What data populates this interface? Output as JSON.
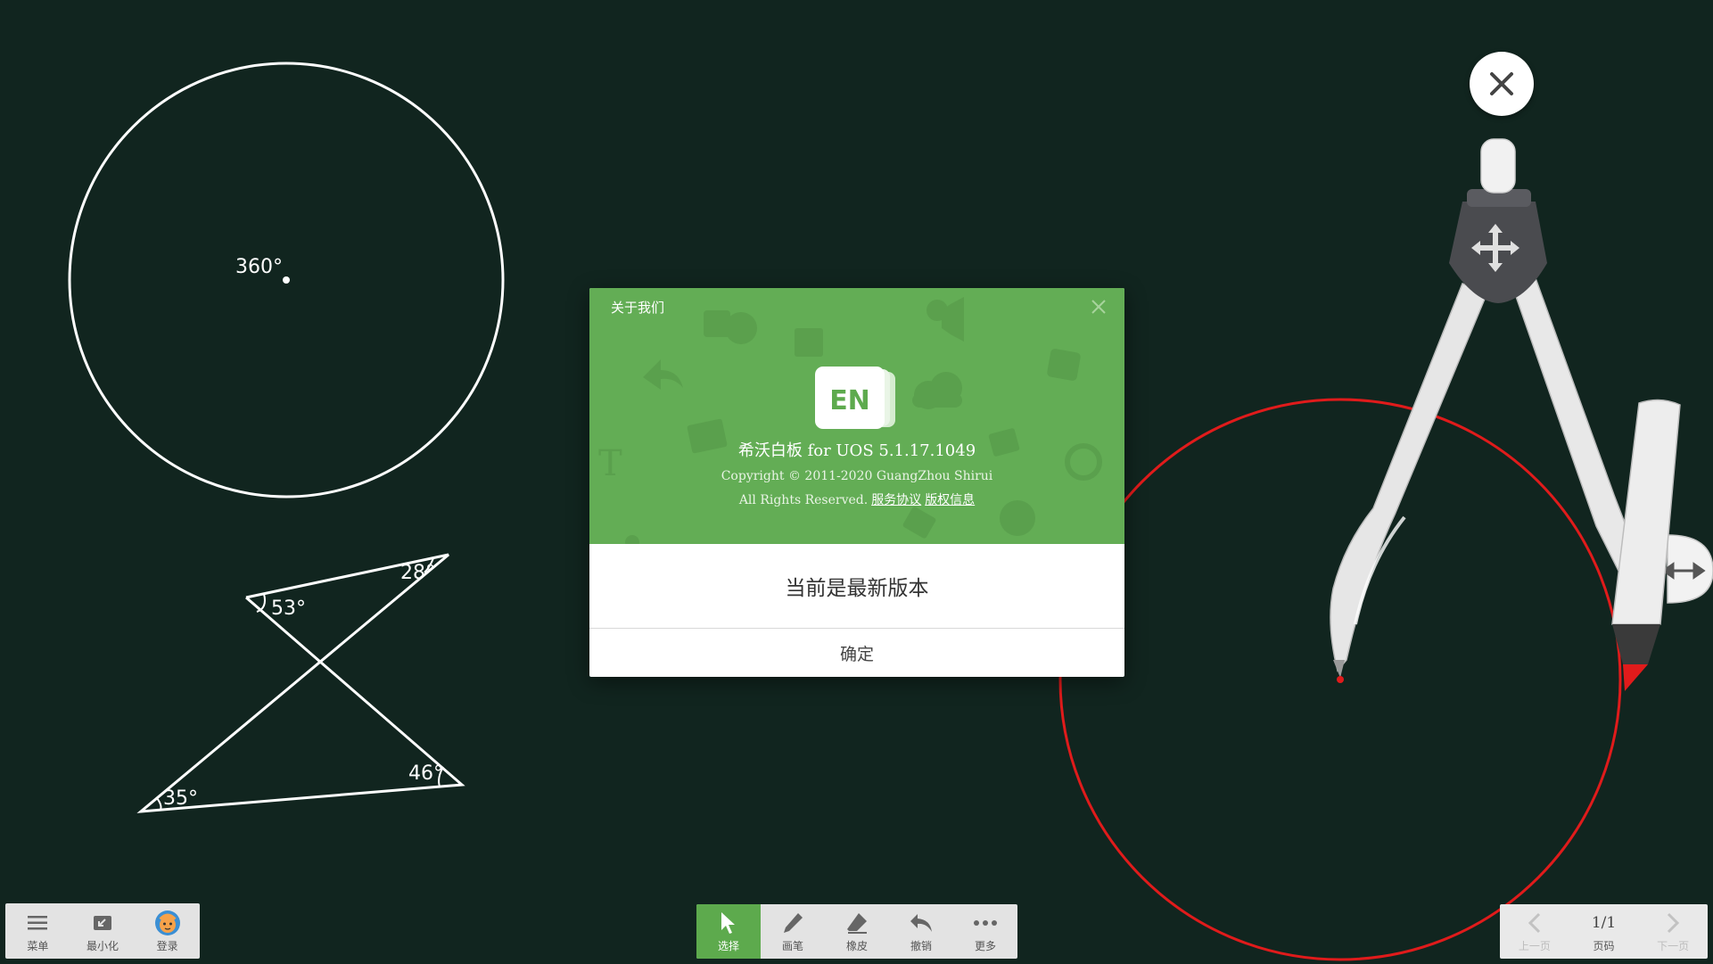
{
  "board": {
    "circle_label": "360°",
    "angles": [
      "28°",
      "53°",
      "46°",
      "35°"
    ]
  },
  "dialog": {
    "title": "关于我们",
    "app_name": "希沃白板 for UOS 5.1.17.1049",
    "copyright": "Copyright © 2011-2020 GuangZhou Shirui",
    "rights": "All Rights Reserved.",
    "link_service": "服务协议",
    "link_copyright": "版权信息",
    "logo_text": "EN",
    "status": "当前是最新版本",
    "ok_label": "确定"
  },
  "left_bar": {
    "menu_label": "菜单",
    "minimize_label": "最小化",
    "login_label": "登录"
  },
  "toolbar": {
    "select_label": "选择",
    "pen_label": "画笔",
    "eraser_label": "橡皮",
    "undo_label": "撤销",
    "more_label": "更多"
  },
  "pager": {
    "prev_label": "上一页",
    "page_value": "1/1",
    "page_label": "页码",
    "next_label": "下一页"
  },
  "colors": {
    "board": "#11251f",
    "accent_green": "#63ad55",
    "compass_circle": "#e01b1b"
  },
  "icons": [
    "close-icon",
    "move-icon",
    "resize-icon",
    "menu-icon",
    "minimize-icon",
    "avatar-icon",
    "cursor-icon",
    "pen-icon",
    "eraser-icon",
    "undo-icon",
    "more-icon",
    "chevron-left-icon",
    "chevron-right-icon"
  ]
}
